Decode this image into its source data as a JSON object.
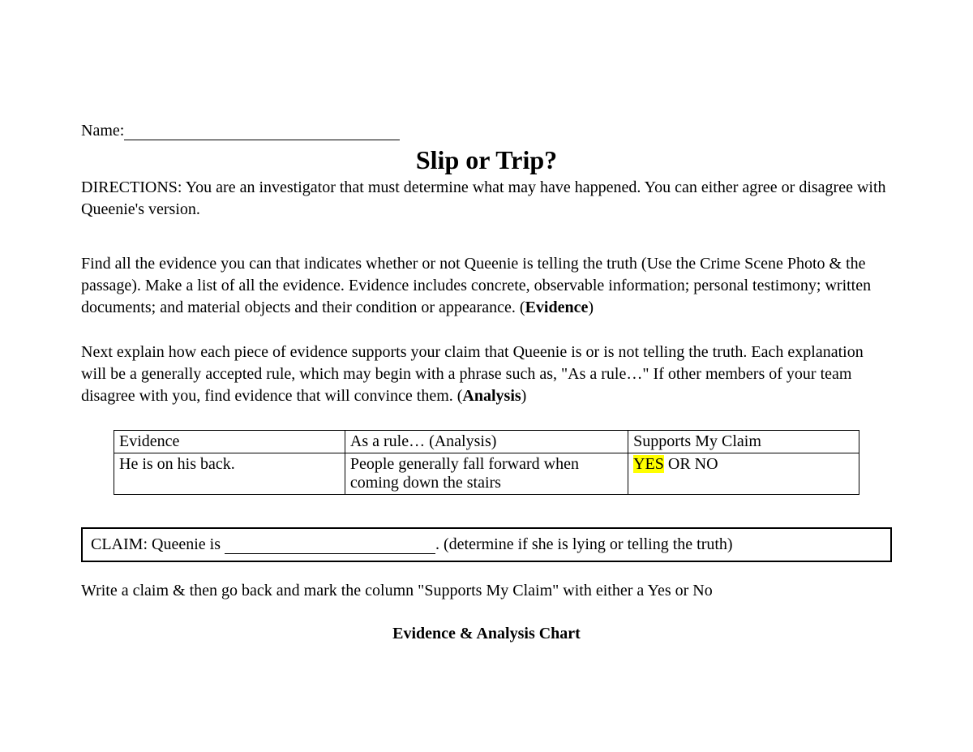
{
  "name_label": "Name:",
  "title": "Slip or Trip?",
  "directions_label": "DIRECTIONS:",
  "directions_text": "  You are an investigator that must determine what may have happened.  You can either agree or disagree with Queenie's version.",
  "para_evidence_pre": "Find all the evidence you can that indicates whether or not Queenie is telling the truth (Use the Crime Scene Photo & the passage).  Make a list of all the evidence.  Evidence includes concrete, observable information; personal testimony; written documents; and material objects and their condition or appearance. (",
  "evidence_bold": "Evidence",
  "para_evidence_post": ")",
  "para_analysis_pre": "Next explain how each piece of evidence supports your claim that Queenie is or is not telling the truth.  Each explanation will be a generally accepted rule, which may begin with a phrase such as, \"As a rule…\"  If other members of your team disagree with you, find evidence that will convince them. (",
  "analysis_bold": "Analysis",
  "para_analysis_post": ")",
  "table": {
    "headers": {
      "evidence": "Evidence",
      "analysis": "As a rule… (Analysis)",
      "supports": "Supports My Claim"
    },
    "row1": {
      "evidence": "He is on his back.",
      "analysis": "People generally fall forward when coming down the stairs",
      "supports_yes": "YES",
      "supports_rest": " OR NO"
    }
  },
  "claim_label": "CLAIM:   Queenie is ",
  "claim_post": ". (determine if she is lying or telling the truth)",
  "instruction_pre": "Write a claim & then go back and mark the column \"Supports My Claim\" with either a ",
  "instruction_yes": "Yes",
  "instruction_or": " or ",
  "instruction_no": "No",
  "chart_heading": "Evidence & Analysis Chart"
}
